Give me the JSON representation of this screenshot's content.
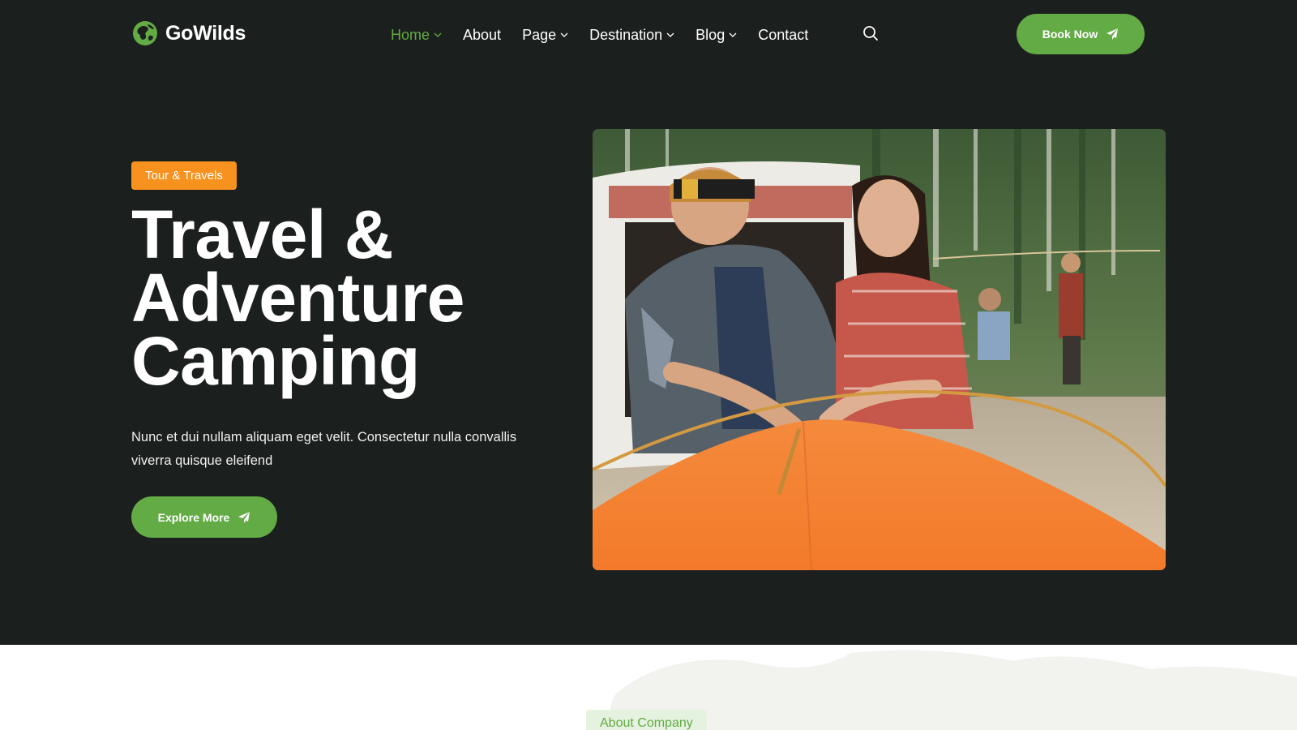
{
  "header": {
    "brand": "GoWilds",
    "nav": [
      {
        "label": "Home",
        "dropdown": true,
        "active": true
      },
      {
        "label": "About",
        "dropdown": false,
        "active": false
      },
      {
        "label": "Page",
        "dropdown": true,
        "active": false
      },
      {
        "label": "Destination",
        "dropdown": true,
        "active": false
      },
      {
        "label": "Blog",
        "dropdown": true,
        "active": false
      },
      {
        "label": "Contact",
        "dropdown": false,
        "active": false
      }
    ],
    "search_icon": "search-icon",
    "book_button": "Book Now",
    "book_icon": "paper-plane-icon"
  },
  "hero": {
    "badge": "Tour & Travels",
    "title_lines": [
      "Travel &",
      "Adventure",
      "Camping"
    ],
    "description": "Nunc et dui nullam aliquam eget velit. Consectetur nulla convallis viverra quisque eleifend",
    "cta_label": "Explore More",
    "cta_icon": "paper-plane-icon",
    "image": "photo of a couple pitching an orange tent at a forest campsite"
  },
  "about": {
    "label": "About Company"
  },
  "colors": {
    "background_dark": "#1b1f1d",
    "accent_green": "#63ab45",
    "badge_orange": "#f7921e",
    "about_label_bg": "#e5f2df"
  }
}
